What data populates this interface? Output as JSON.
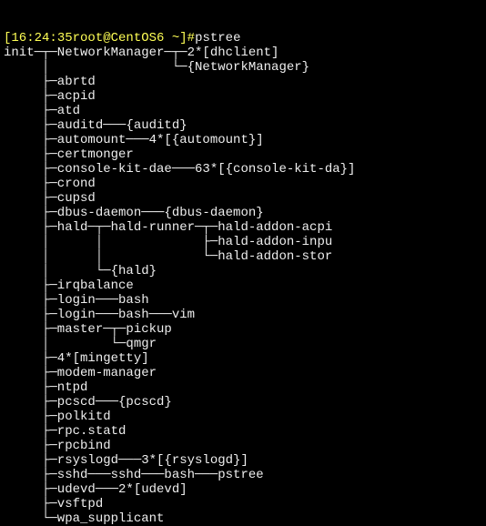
{
  "prompt": {
    "open_bracket": "[",
    "time": "16:24:35",
    "user_host": "root@CentOS6",
    "cwd": " ~",
    "close_bracket": "]",
    "hash": "#",
    "command": "pstree"
  },
  "tree": {
    "l01": "init─┬─NetworkManager─┬─2*[dhclient]",
    "l02": "     │                └─{NetworkManager}",
    "l03": "     ├─abrtd",
    "l04": "     ├─acpid",
    "l05": "     ├─atd",
    "l06": "     ├─auditd───{auditd}",
    "l07": "     ├─automount───4*[{automount}]",
    "l08": "     ├─certmonger",
    "l09": "     ├─console-kit-dae───63*[{console-kit-da}]",
    "l10": "     ├─crond",
    "l11": "     ├─cupsd",
    "l12": "     ├─dbus-daemon───{dbus-daemon}",
    "l13": "     ├─hald─┬─hald-runner─┬─hald-addon-acpi",
    "l14": "     │      │             ├─hald-addon-inpu",
    "l15": "     │      │             └─hald-addon-stor",
    "l16": "     │      └─{hald}",
    "l17": "     ├─irqbalance",
    "l18": "     ├─login───bash",
    "l19": "     ├─login───bash───vim",
    "l20": "     ├─master─┬─pickup",
    "l21": "     │        └─qmgr",
    "l22": "     ├─4*[mingetty]",
    "l23": "     ├─modem-manager",
    "l24": "     ├─ntpd",
    "l25": "     ├─pcscd───{pcscd}",
    "l26": "     ├─polkitd",
    "l27": "     ├─rpc.statd",
    "l28": "     ├─rpcbind",
    "l29": "     ├─rsyslogd───3*[{rsyslogd}]",
    "l30": "     ├─sshd───sshd───bash───pstree",
    "l31": "     ├─udevd───2*[udevd]",
    "l32": "     ├─vsftpd",
    "l33": "     └─wpa_supplicant"
  }
}
